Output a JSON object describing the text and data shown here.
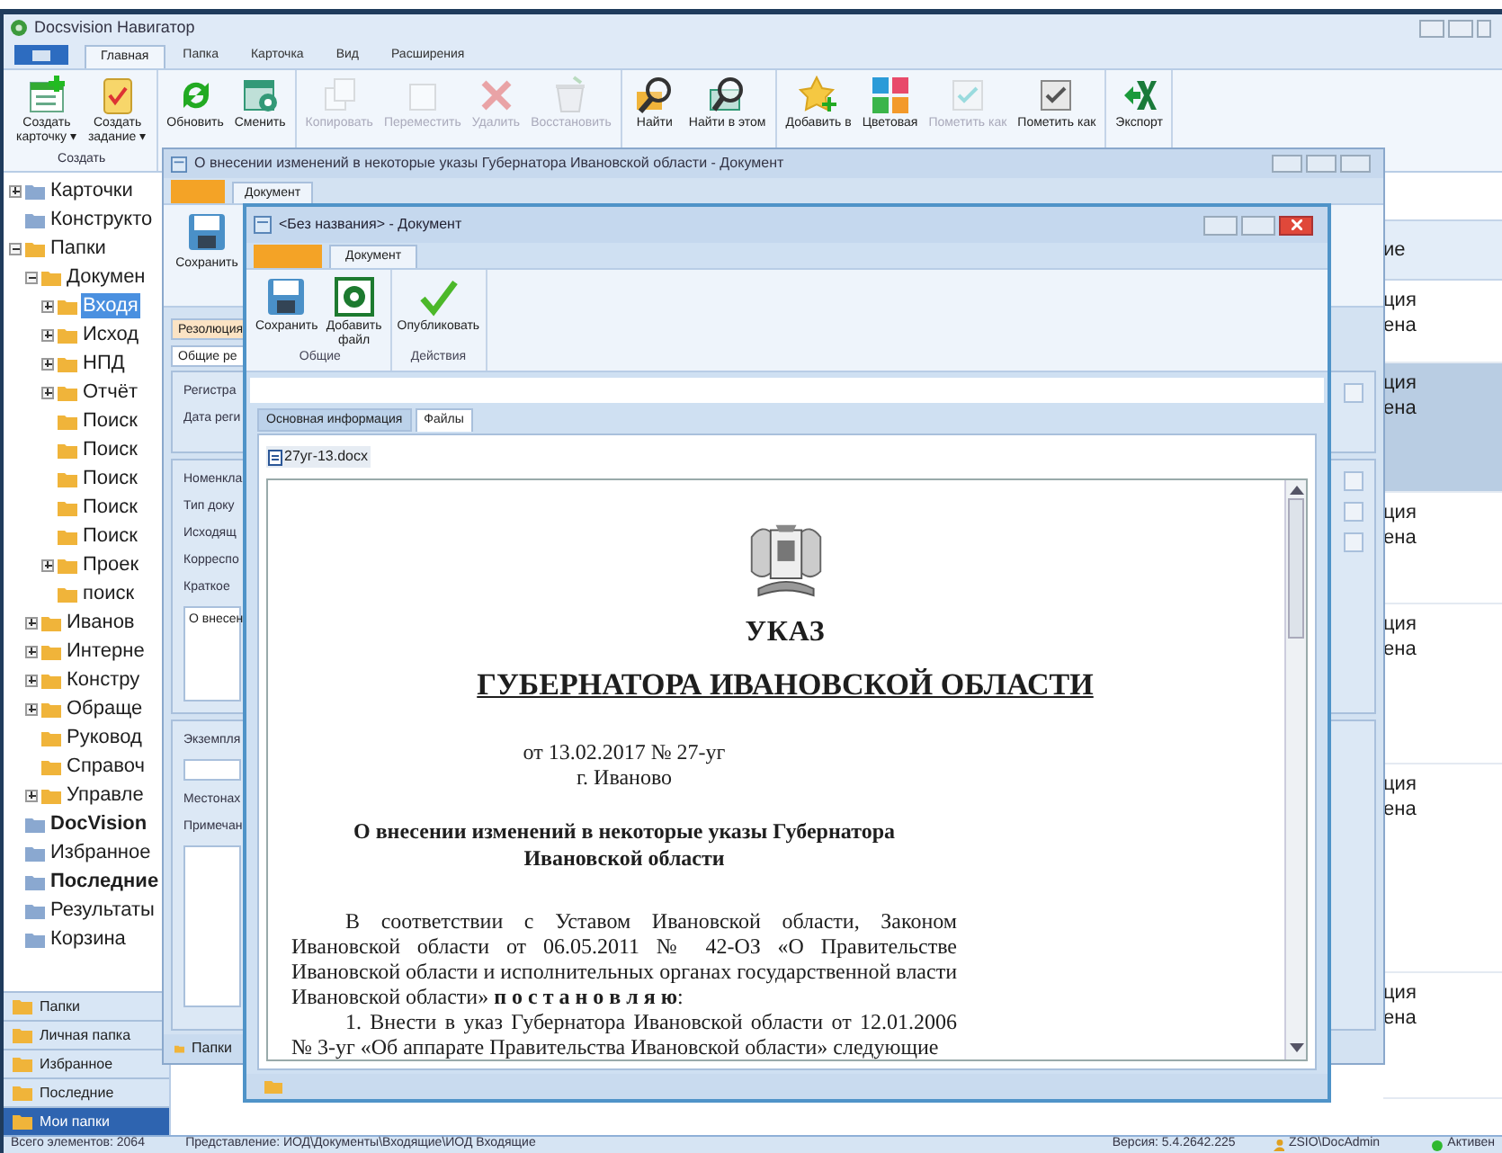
{
  "main_window": {
    "title": "Docsvision Навигатор"
  },
  "ribbon": {
    "tabs": [
      {
        "label": "Главная",
        "selected": true
      },
      {
        "label": "Папка",
        "selected": false
      },
      {
        "label": "Карточка",
        "selected": false
      },
      {
        "label": "Вид",
        "selected": false
      },
      {
        "label": "Расширения",
        "selected": false
      }
    ],
    "groups": [
      {
        "label": "Создать",
        "buttons": [
          {
            "label": "Создать\nкарточку ▾",
            "disabled": false
          },
          {
            "label": "Создать\nзадание ▾",
            "disabled": false
          }
        ]
      },
      {
        "buttons": [
          {
            "label": "Обновить",
            "disabled": false
          },
          {
            "label": "Сменить",
            "disabled": false
          }
        ]
      },
      {
        "buttons": [
          {
            "label": "Копировать",
            "disabled": true
          },
          {
            "label": "Переместить",
            "disabled": true
          },
          {
            "label": "Удалить",
            "disabled": true
          },
          {
            "label": "Восстановить",
            "disabled": true
          }
        ]
      },
      {
        "buttons": [
          {
            "label": "Найти",
            "disabled": false
          },
          {
            "label": "Найти в этом",
            "disabled": false
          }
        ]
      },
      {
        "buttons": [
          {
            "label": "Добавить в",
            "disabled": false
          },
          {
            "label": "Цветовая",
            "disabled": false
          },
          {
            "label": "Пометить как",
            "disabled": true
          },
          {
            "label": "Пометить как",
            "disabled": false
          }
        ]
      },
      {
        "buttons": [
          {
            "label": "Экспорт",
            "disabled": false
          }
        ]
      }
    ]
  },
  "tree": [
    {
      "label": "Карточки",
      "expanded": false,
      "bold": false,
      "selected": false
    },
    {
      "label": "Конструкто",
      "bold": false,
      "selected": false
    },
    {
      "label": "Папки",
      "expanded": true,
      "bold": false,
      "selected": false,
      "children": [
        {
          "label": "Докумен",
          "expanded": true,
          "selected": false,
          "children": [
            {
              "label": "Входя",
              "expanded": false,
              "selected": true
            },
            {
              "label": "Исход",
              "expanded": false,
              "selected": false
            },
            {
              "label": "НПД",
              "expanded": false,
              "selected": false
            },
            {
              "label": "Отчёт",
              "expanded": false,
              "selected": false
            },
            {
              "label": "Поиск",
              "selected": false
            },
            {
              "label": "Поиск",
              "selected": false
            },
            {
              "label": "Поиск",
              "selected": false
            },
            {
              "label": "Поиск",
              "selected": false
            },
            {
              "label": "Поиск",
              "selected": false
            },
            {
              "label": "Проек",
              "expanded": false,
              "selected": false
            },
            {
              "label": "поиск",
              "selected": false
            }
          ]
        },
        {
          "label": "Иванов",
          "expanded": false,
          "selected": false
        },
        {
          "label": "Интерне",
          "expanded": false,
          "selected": false
        },
        {
          "label": "Констру",
          "expanded": false,
          "selected": false
        },
        {
          "label": "Обраще",
          "expanded": false,
          "selected": false
        },
        {
          "label": "Руковод",
          "selected": false
        },
        {
          "label": "Справоч",
          "selected": false
        },
        {
          "label": "Управле",
          "expanded": false,
          "selected": false
        }
      ]
    },
    {
      "label": "DocVision",
      "bold": true,
      "selected": false
    },
    {
      "label": "Избранное",
      "bold": false,
      "selected": false
    },
    {
      "label": "Последние",
      "bold": true,
      "selected": false
    },
    {
      "label": "Результаты",
      "bold": false,
      "selected": false
    },
    {
      "label": "Корзина",
      "bold": false,
      "selected": false
    }
  ],
  "nav_panes": [
    {
      "label": "Папки",
      "selected": false
    },
    {
      "label": "Личная папка",
      "selected": false
    },
    {
      "label": "Избранное",
      "selected": false
    },
    {
      "label": "Последние",
      "selected": false
    },
    {
      "label": "Мои папки",
      "selected": true
    }
  ],
  "list": {
    "column_1": "ие",
    "rows": [
      {
        "line_1": "ция",
        "line_2": "ена",
        "selected": false
      },
      {
        "line_1": "ция",
        "line_2": "ена",
        "selected": true
      },
      {
        "line_1": "ция",
        "line_2": "ена",
        "selected": false
      },
      {
        "line_1": "ция",
        "line_2": "ена",
        "selected": false
      },
      {
        "line_1": "ция",
        "line_2": "ена",
        "selected": false
      },
      {
        "line_1": "ция",
        "line_2": "ена",
        "selected": false
      }
    ]
  },
  "card_window": {
    "title": "О внесении изменений в некоторые указы Губернатора Ивановской области - Документ",
    "ribbon_tab": "Документ",
    "save": "Сохранить",
    "tabs": [
      {
        "label": "Резолюция",
        "selected": true
      },
      {
        "label": "Общие ре",
        "selected": true
      }
    ],
    "sections": [
      {
        "labels": [
          "Регистра",
          "Дата реги"
        ]
      },
      {
        "labels": [
          "Номенкла",
          "Тип доку",
          "Исходящ",
          "Корреспо",
          "Краткое"
        ],
        "text": "О внесен"
      },
      {
        "labels": [
          "Экземпля"
        ],
        "labels_2": [
          "Местонах",
          "Примечан"
        ]
      }
    ],
    "footer": "Папки"
  },
  "doc_window": {
    "title": "<Без названия> - Документ",
    "ribbon_tab": "Документ",
    "groups": [
      {
        "label": "Общие",
        "buttons": [
          "Сохранить",
          "Добавить\nфайл"
        ]
      },
      {
        "label": "Действия",
        "buttons": [
          "Опубликовать"
        ]
      }
    ],
    "tabs": [
      {
        "label": "Основная информация",
        "selected": false
      },
      {
        "label": "Файлы",
        "selected": true
      }
    ],
    "files": [
      "27уг-13.docx"
    ],
    "document": {
      "heading": "УКАЗ",
      "authority": "ГУБЕРНАТОРА ИВАНОВСКОЙ ОБЛАСТИ",
      "date": "от 13.02.2017 № 27-уг",
      "place": "г. Иваново",
      "title": "О внесении изменений в некоторые указы Губернатора Ивановской области",
      "paragraphs": [
        "В соответствии с Уставом Ивановской области, Законом Ивановской области от 06.05.2011 № 42-ОЗ «О Правительстве Ивановской области и исполнительных органах государственной власти Ивановской области» **п о с т а н о в л я ю**:",
        "1. Внести в указ Губернатора Ивановской области от 12.01.2006 № 3-уг «Об аппарате Правительства Ивановской области» следующие"
      ]
    }
  },
  "status_bar": [
    "Всего элементов: 2064",
    "Представление: ИОД\\Документы\\Входящие\\ИОД Входящие",
    "Версия: 5.4.2642.225",
    "ZSIO\\DocAdmin",
    "Активен"
  ]
}
